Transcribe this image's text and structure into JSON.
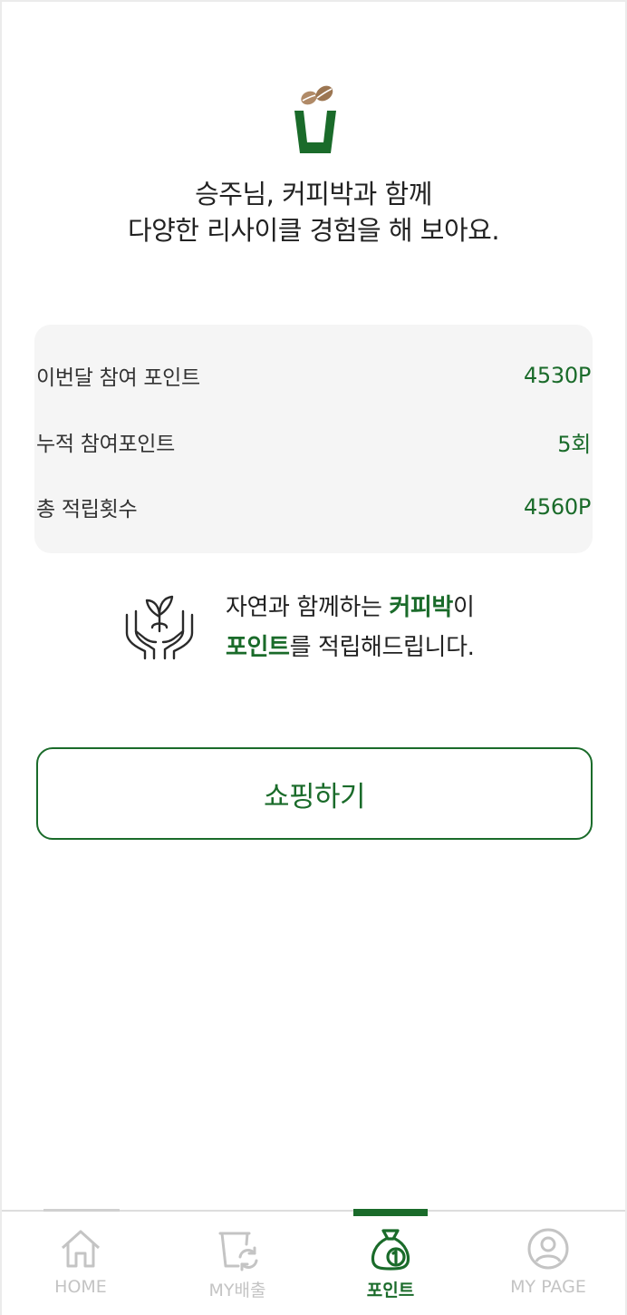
{
  "colors": {
    "brand_green": "#1a6b2a",
    "coffee_brown": "#a88462",
    "card_bg": "#f5f5f5",
    "inactive_tab": "#c4c4c4"
  },
  "logo": {
    "icon": "coffee-bean-cup-logo"
  },
  "greeting": {
    "line1": "승주님, 커피박과 함께",
    "line2": "다양한 리사이클 경험을 해 보아요."
  },
  "points": [
    {
      "label": "이번달 참여 포인트",
      "value": "4530P"
    },
    {
      "label": "누적 참여포인트",
      "value": "5회"
    },
    {
      "label": "총 적립횟수",
      "value": "4560P"
    }
  ],
  "promo": {
    "icon": "hands-sprout-icon",
    "line1_prefix": "자연과 함께하는 ",
    "line1_highlight": "커피박",
    "line1_suffix": "이",
    "line2_highlight": "포인트",
    "line2_suffix": "를 적립해드립니다."
  },
  "shop_button": {
    "label": "쇼핑하기"
  },
  "tabbar": {
    "active": "포인트",
    "tabs": [
      {
        "label": "HOME",
        "icon": "home-icon"
      },
      {
        "label": "MY배출",
        "icon": "recycle-cup-icon"
      },
      {
        "label": "포인트",
        "icon": "money-bag-icon"
      },
      {
        "label": "MY PAGE",
        "icon": "user-circle-icon"
      }
    ]
  }
}
